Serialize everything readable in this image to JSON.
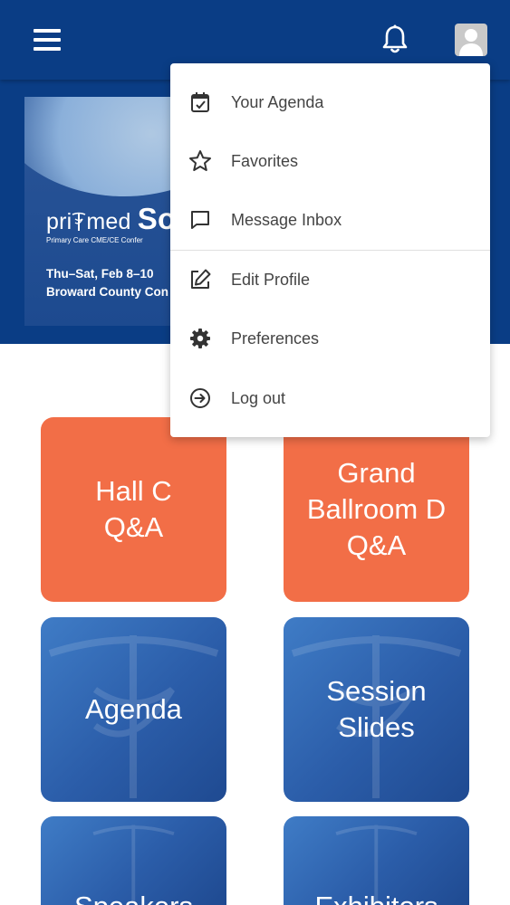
{
  "banner": {
    "brand_prefix": "pri",
    "brand_mid": "med",
    "brand_event": "So",
    "tagline": "Primary Care CME/CE Confer",
    "dates": "Thu–Sat, Feb 8–10",
    "venue": "Broward County Con"
  },
  "user_menu": {
    "items": [
      {
        "label": "Your Agenda",
        "icon": "calendar-check-icon"
      },
      {
        "label": "Favorites",
        "icon": "star-icon"
      },
      {
        "label": "Message Inbox",
        "icon": "message-icon"
      },
      {
        "label": "Edit Profile",
        "icon": "edit-icon"
      },
      {
        "label": "Preferences",
        "icon": "gear-icon"
      },
      {
        "label": "Log out",
        "icon": "logout-icon"
      }
    ]
  },
  "tiles": [
    {
      "label": "Hall C Q&A",
      "style": "orange"
    },
    {
      "label": "Grand Ballroom D Q&A",
      "style": "orange"
    },
    {
      "label": "Agenda",
      "style": "blue"
    },
    {
      "label": "Session Slides",
      "style": "blue"
    },
    {
      "label": "Speakers",
      "style": "blue"
    },
    {
      "label": "Exhibitors",
      "style": "blue"
    }
  ],
  "colors": {
    "header": "#0a3d85",
    "tile_orange": "#f26e47",
    "tile_blue": "#2b5da9"
  }
}
